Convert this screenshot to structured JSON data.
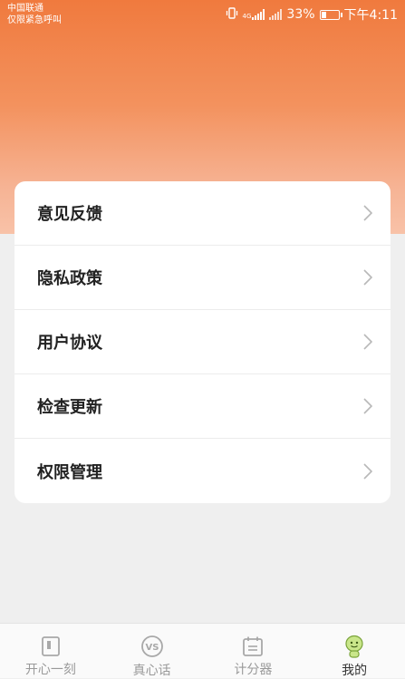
{
  "status_bar": {
    "carrier_line1": "中国联通",
    "carrier_line2": "仅限紧急呼叫",
    "network_label": "4G",
    "battery_text": "33%",
    "battery_level": 0.33,
    "time": "下午4:11"
  },
  "colors": {
    "header_top": "#f07a3e",
    "header_bottom": "#f8c2a8",
    "page_background": "#efefef",
    "active_tab_icon": "#c9e68a"
  },
  "menu": {
    "items": [
      {
        "label": "意见反馈"
      },
      {
        "label": "隐私政策"
      },
      {
        "label": "用户协议"
      },
      {
        "label": "检查更新"
      },
      {
        "label": "权限管理"
      }
    ]
  },
  "tabbar": {
    "tabs": [
      {
        "label": "开心一刻",
        "icon": "notebook-icon",
        "active": false
      },
      {
        "label": "真心话",
        "icon": "vs-icon",
        "active": false
      },
      {
        "label": "计分器",
        "icon": "calendar-icon",
        "active": false
      },
      {
        "label": "我的",
        "icon": "smiley-avatar-icon",
        "active": true
      }
    ]
  }
}
